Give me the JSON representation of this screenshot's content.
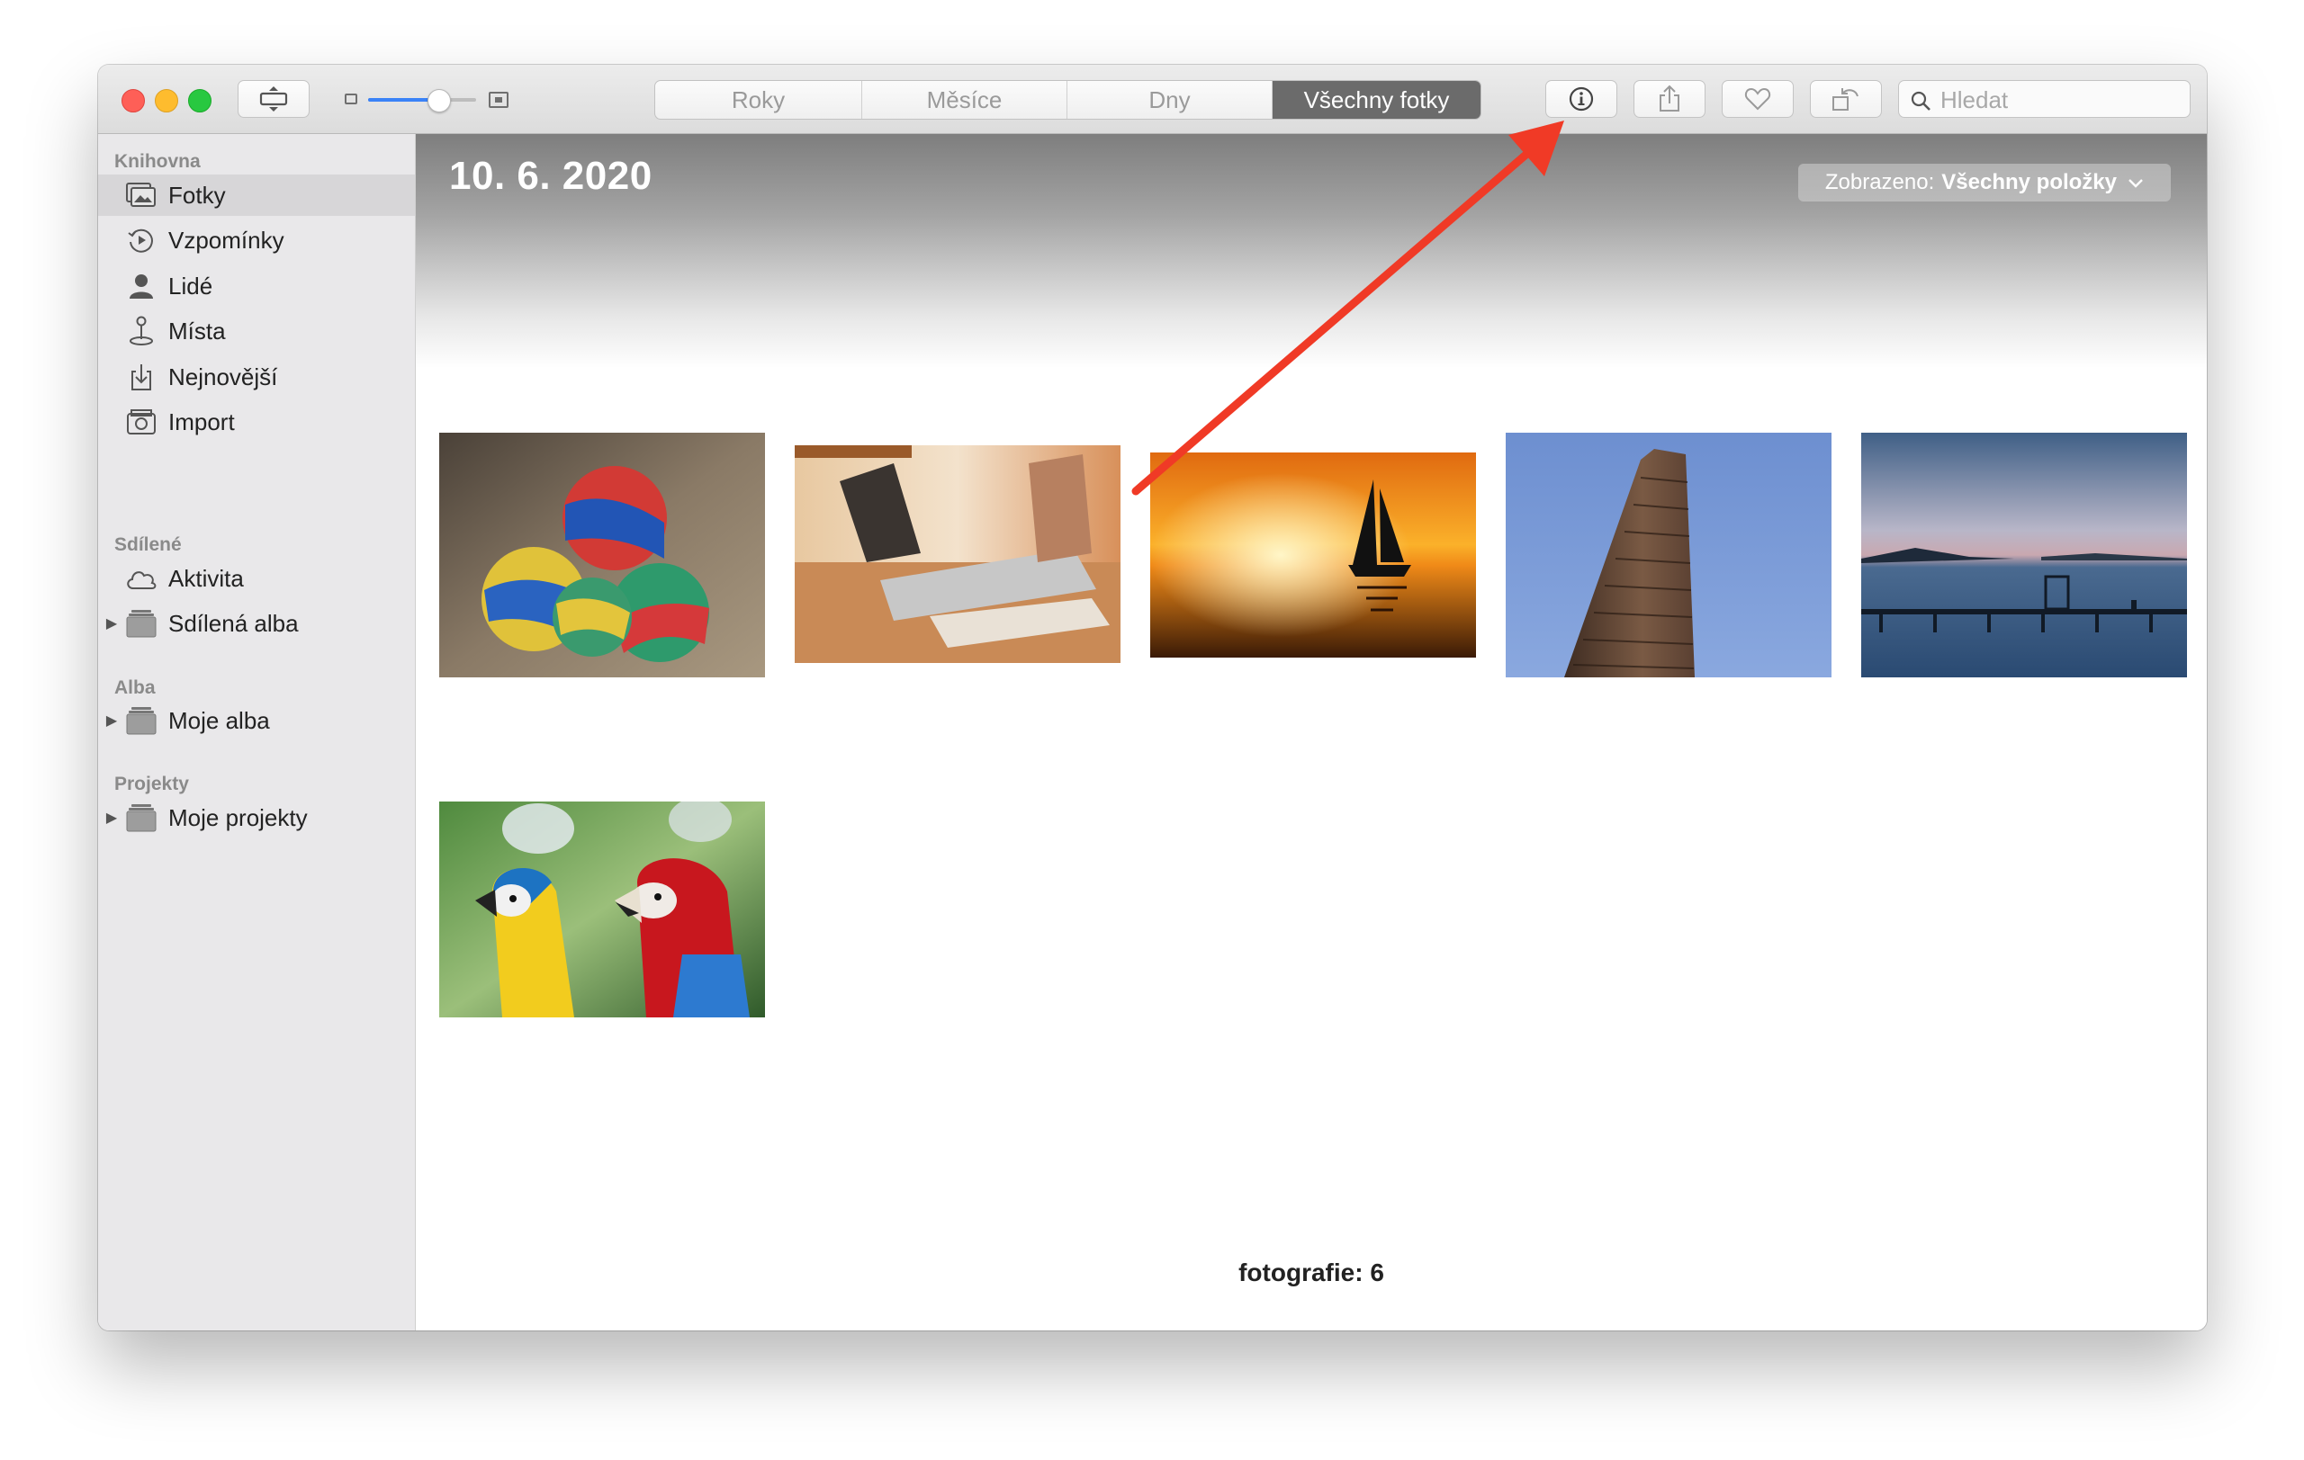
{
  "toolbar": {
    "tabs": [
      {
        "label": "Roky",
        "active": false
      },
      {
        "label": "Měsíce",
        "active": false
      },
      {
        "label": "Dny",
        "active": false
      },
      {
        "label": "Všechny fotky",
        "active": true
      }
    ],
    "zoom_level": 0.55,
    "search_placeholder": "Hledat",
    "icons": [
      "sidebar-toggle-icon",
      "info-icon",
      "share-icon",
      "heart-icon",
      "rotate-icon",
      "search-icon"
    ]
  },
  "sidebar": {
    "sections": {
      "library": "Knihovna",
      "shared": "Sdílené",
      "albums": "Alba",
      "projects": "Projekty"
    },
    "items": {
      "photos": "Fotky",
      "memories": "Vzpomínky",
      "people": "Lidé",
      "places": "Místa",
      "recent": "Nejnovější",
      "import": "Import",
      "activity": "Aktivita",
      "shared_albums": "Sdílená alba",
      "my_albums": "Moje alba",
      "my_projects": "Moje projekty"
    },
    "selected": "photos"
  },
  "main": {
    "date": "10. 6. 2020",
    "showing_label": "Zobrazeno:",
    "showing_value": "Všechny položky",
    "photos": [
      "juggling-balls",
      "laptop",
      "sailboat-sunset",
      "flatiron-building",
      "pier-lake",
      "parrots"
    ],
    "photo_count": "fotografie: 6"
  },
  "colors": {
    "accent": "#3a82f7",
    "active_tab": "#6b6b6b",
    "annotation_arrow": "#f03a26"
  }
}
